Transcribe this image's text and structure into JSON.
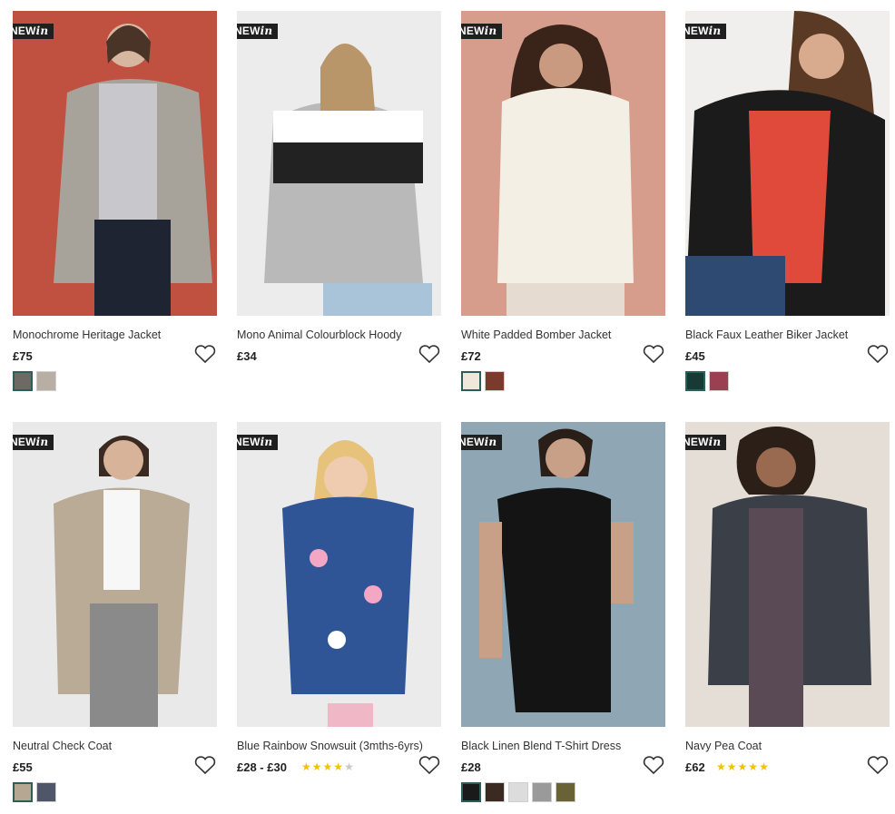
{
  "badge": {
    "prefix": "NEW",
    "suffix": "in"
  },
  "products": [
    {
      "name": "Monochrome Heritage Jacket",
      "price": "£75",
      "rating": null,
      "swatches": [
        "#6d6a66",
        "#b8aea3"
      ],
      "bg": "#c0503f",
      "accent": "#a8a39a"
    },
    {
      "name": "Mono Animal Colourblock Hoody",
      "price": "£34",
      "rating": null,
      "swatches": [],
      "bg": "#ececec",
      "accent": "#9e9e9e"
    },
    {
      "name": "White Padded Bomber Jacket",
      "price": "£72",
      "rating": null,
      "swatches": [
        "#efe8da",
        "#7a3a2c"
      ],
      "bg": "#d79d8c",
      "accent": "#f4efe4"
    },
    {
      "name": "Black Faux Leather Biker Jacket",
      "price": "£45",
      "rating": null,
      "swatches": [
        "#173a35",
        "#9a4051"
      ],
      "bg": "#f0efed",
      "accent": "#1b1b1b"
    },
    {
      "name": "Neutral Check Coat",
      "price": "£55",
      "rating": null,
      "swatches": [
        "#b5a792",
        "#4e5668"
      ],
      "bg": "#e9e9ea",
      "accent": "#b9ab95"
    },
    {
      "name": "Blue Rainbow Snowsuit (3mths-6yrs)",
      "price": "£28 - £30",
      "rating": 4,
      "swatches": [],
      "bg": "#ebebeb",
      "accent": "#2f5596"
    },
    {
      "name": "Black Linen Blend T-Shirt Dress",
      "price": "£28",
      "rating": null,
      "swatches": [
        "#1a1a1a",
        "#3a2a22",
        "#dcdcdc",
        "#9a9a9a",
        "#6a6237"
      ],
      "bg": "#8fa6b4",
      "accent": "#141414"
    },
    {
      "name": "Navy Pea Coat",
      "price": "£62",
      "rating": 5,
      "swatches": [],
      "bg": "#e4ded7",
      "accent": "#3b3f48"
    }
  ]
}
